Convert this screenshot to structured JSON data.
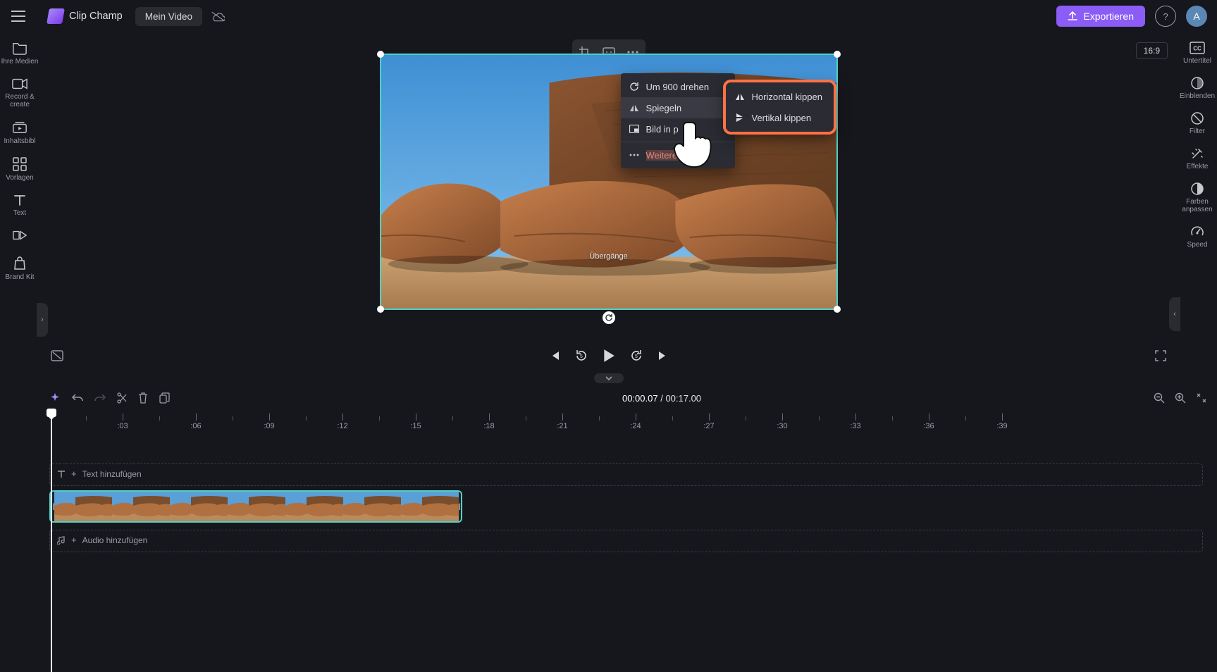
{
  "header": {
    "brand": "Clip Champ",
    "project_name": "Mein Video",
    "export_label": "Exportieren",
    "avatar_letter": "A"
  },
  "left_rail": {
    "items": [
      {
        "label": "Ihre Medien"
      },
      {
        "label": "Record &amp; create"
      },
      {
        "label": "Inhaltsbibl"
      },
      {
        "label": "Vorlagen"
      },
      {
        "label": "Text"
      },
      {
        "label": ""
      },
      {
        "label": "Brand Kit"
      }
    ]
  },
  "right_rail": {
    "items": [
      {
        "label": "Untertitel"
      },
      {
        "label": "Einblenden"
      },
      {
        "label": "Filter"
      },
      {
        "label": "Effekte"
      },
      {
        "label": "Farben anpassen"
      },
      {
        "label": "Speed"
      }
    ]
  },
  "canvas": {
    "aspect": "16:9",
    "preview_caption": "Übergänge",
    "context_menu": {
      "rotate": "Um 900 drehen",
      "mirror": "Spiegeln",
      "pip": "Bild in p",
      "more": "Weitere Option"
    },
    "sub_menu": {
      "horizontal": "Horizontal kippen",
      "vertical": "Vertikal kippen"
    }
  },
  "timeline": {
    "current_time": "00:00.07",
    "total_time": "00:17.00",
    "ruler_labels": [
      ":03",
      ":06",
      ":09",
      ":12",
      ":15",
      ":18",
      ":21",
      ":24",
      ":27",
      ":30",
      ":33",
      ":36",
      ":39"
    ],
    "text_track_label": "Text hinzufügen",
    "audio_track_label": "Audio hinzufügen"
  }
}
